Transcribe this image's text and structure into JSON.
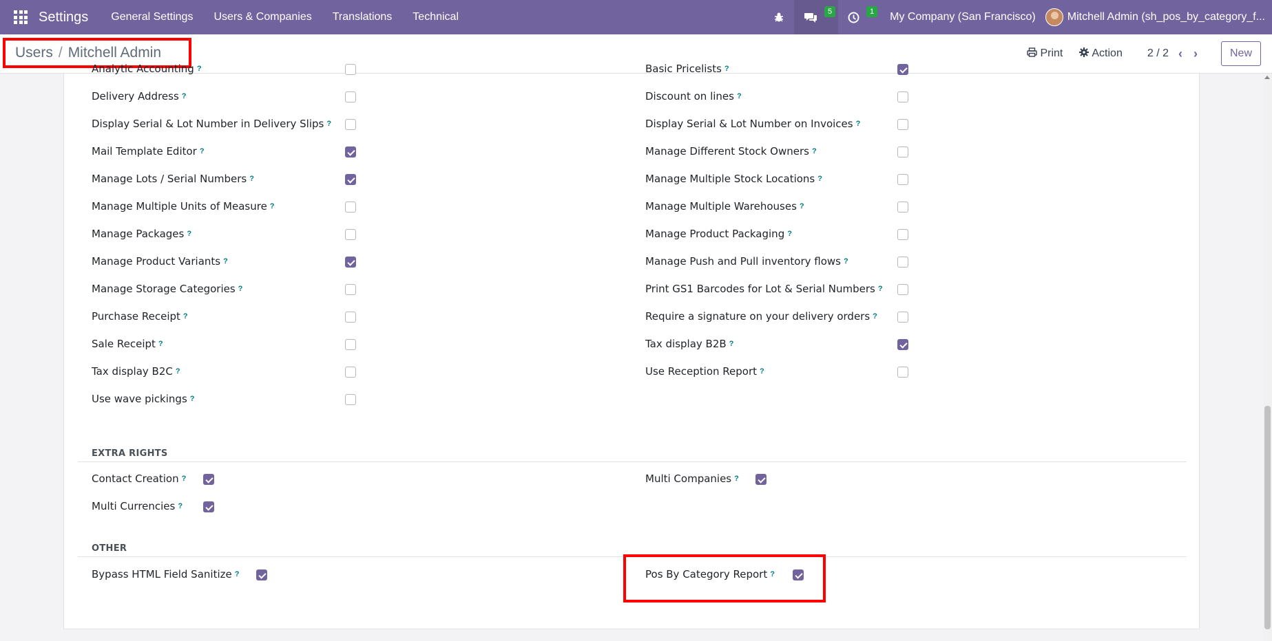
{
  "navbar": {
    "brand": "Settings",
    "menu": [
      "General Settings",
      "Users & Companies",
      "Translations",
      "Technical"
    ],
    "messages_count": "5",
    "activities_count": "1",
    "company": "My Company (San Francisco)",
    "user": "Mitchell Admin (sh_pos_by_category_f..."
  },
  "breadcrumb": {
    "parent": "Users",
    "current": "Mitchell Admin"
  },
  "control": {
    "print": "Print",
    "action": "Action",
    "pager": "2 / 2",
    "new": "New"
  },
  "technical_left": [
    {
      "label": "Analytic Accounting",
      "checked": false
    },
    {
      "label": "Delivery Address",
      "checked": false
    },
    {
      "label": "Display Serial & Lot Number in Delivery Slips",
      "checked": false
    },
    {
      "label": "Mail Template Editor",
      "checked": true
    },
    {
      "label": "Manage Lots / Serial Numbers",
      "checked": true
    },
    {
      "label": "Manage Multiple Units of Measure",
      "checked": false
    },
    {
      "label": "Manage Packages",
      "checked": false
    },
    {
      "label": "Manage Product Variants",
      "checked": true
    },
    {
      "label": "Manage Storage Categories",
      "checked": false
    },
    {
      "label": "Purchase Receipt",
      "checked": false
    },
    {
      "label": "Sale Receipt",
      "checked": false
    },
    {
      "label": "Tax display B2C",
      "checked": false
    },
    {
      "label": "Use wave pickings",
      "checked": false
    }
  ],
  "technical_right": [
    {
      "label": "Basic Pricelists",
      "checked": true
    },
    {
      "label": "Discount on lines",
      "checked": false
    },
    {
      "label": "Display Serial & Lot Number on Invoices",
      "checked": false
    },
    {
      "label": "Manage Different Stock Owners",
      "checked": false
    },
    {
      "label": "Manage Multiple Stock Locations",
      "checked": false
    },
    {
      "label": "Manage Multiple Warehouses",
      "checked": false
    },
    {
      "label": "Manage Product Packaging",
      "checked": false
    },
    {
      "label": "Manage Push and Pull inventory flows",
      "checked": false
    },
    {
      "label": "Print GS1 Barcodes for Lot & Serial Numbers",
      "checked": false
    },
    {
      "label": "Require a signature on your delivery orders",
      "checked": false
    },
    {
      "label": "Tax display B2B",
      "checked": true
    },
    {
      "label": "Use Reception Report",
      "checked": false
    }
  ],
  "extra_rights": {
    "title": "EXTRA RIGHTS",
    "left": [
      {
        "label": "Contact Creation",
        "checked": true
      },
      {
        "label": "Multi Currencies",
        "checked": true
      }
    ],
    "right": [
      {
        "label": "Multi Companies",
        "checked": true
      }
    ]
  },
  "other": {
    "title": "OTHER",
    "left": [
      {
        "label": "Bypass HTML Field Sanitize",
        "checked": true
      }
    ],
    "right": [
      {
        "label": "Pos By Category Report",
        "checked": true
      }
    ]
  },
  "help_mark": "?"
}
